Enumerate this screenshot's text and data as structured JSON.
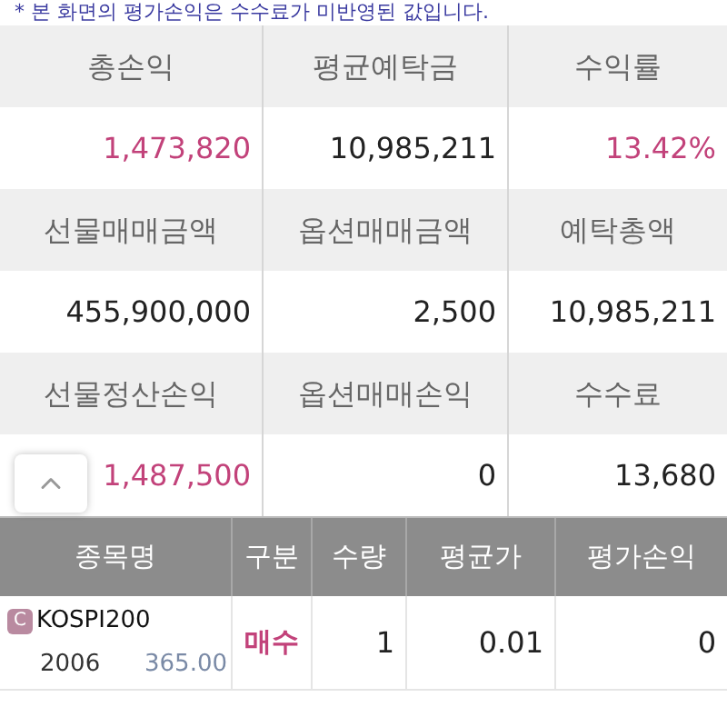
{
  "notice": "* 본 화면의 평가손익은 수수료가 미반영된 값입니다.",
  "summary": [
    [
      {
        "label": "총손익",
        "value": "1,473,820",
        "highlight": true
      },
      {
        "label": "평균예탁금",
        "value": "10,985,211",
        "highlight": false
      },
      {
        "label": "수익률",
        "value": "13.42%",
        "highlight": true
      }
    ],
    [
      {
        "label": "선물매매금액",
        "value": "455,900,000",
        "highlight": false
      },
      {
        "label": "옵션매매금액",
        "value": "2,500",
        "highlight": false
      },
      {
        "label": "예탁총액",
        "value": "10,985,211",
        "highlight": false
      }
    ],
    [
      {
        "label": "선물정산손익",
        "value": "1,487,500",
        "highlight": true
      },
      {
        "label": "옵션매매손익",
        "value": "0",
        "highlight": false
      },
      {
        "label": "수수료",
        "value": "13,680",
        "highlight": false
      }
    ]
  ],
  "table": {
    "columns": [
      "종목명",
      "구분",
      "수량",
      "평균가",
      "평가손익"
    ],
    "rows": [
      {
        "badge": "C",
        "name": "KOSPI200",
        "month": "2006",
        "strike": "365.00",
        "side": "매수",
        "qty": "1",
        "avg": "0.01",
        "pnl": "0"
      }
    ]
  }
}
